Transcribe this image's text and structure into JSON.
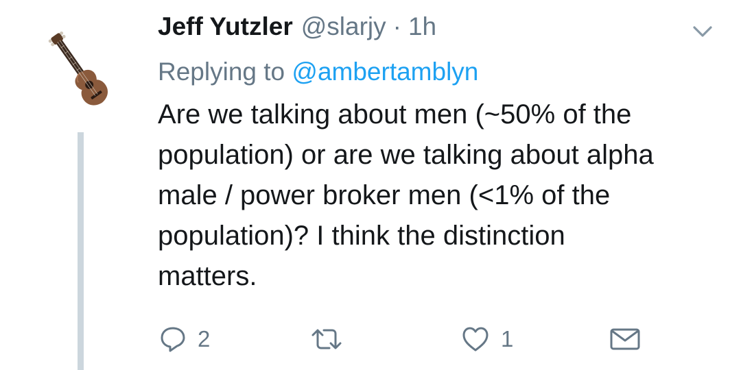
{
  "tweet": {
    "author_name": "Jeff Yutzler",
    "handle": "@slarjy",
    "separator": "·",
    "time": "1h",
    "replying_prefix": "Replying to",
    "replying_to": "@ambertamblyn",
    "body_lines": [
      "Are we talking about men (~50% of the",
      "population) or are we talking about alpha",
      "male / power broker men (<1% of the",
      "population)? I think the distinction",
      "matters."
    ],
    "avatar_icon": "ukulele-icon",
    "actions": {
      "reply_count": "2",
      "retweet_count": "",
      "like_count": "1"
    }
  },
  "colors": {
    "text": "#14171a",
    "secondary": "#657786",
    "link": "#1da1f2",
    "thread_line": "#ccd6dd"
  }
}
